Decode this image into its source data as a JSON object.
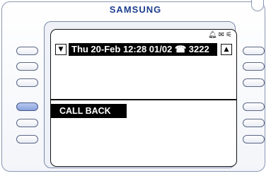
{
  "brand": "SAMSUNG",
  "status_icons": [
    "bell-icon",
    "envelope-icon",
    "speaker-icon"
  ],
  "header": {
    "text": "Thu 20-Feb 12:28 01/02 ☎ 3222",
    "scroll_down": "▼",
    "scroll_up": "▲"
  },
  "softkey": {
    "label": "CALL BACK",
    "active_left_key": 4
  }
}
